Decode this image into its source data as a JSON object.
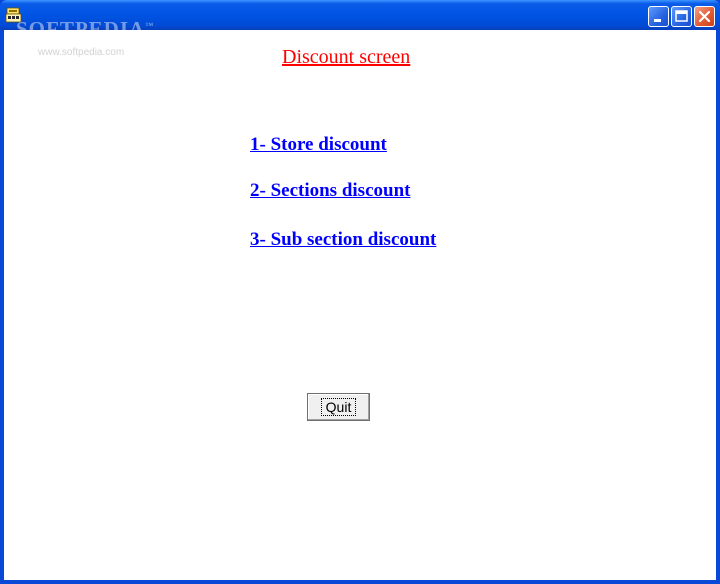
{
  "window": {
    "watermark": "SOFTPEDIA",
    "watermark_tm": "™",
    "watermark_url": "www.softpedia.com"
  },
  "screen": {
    "title": "Discount screen",
    "links": [
      {
        "label": "1- Store discount"
      },
      {
        "label": "2- Sections discount"
      },
      {
        "label": "3- Sub section discount"
      }
    ],
    "quit_label": "Quit"
  },
  "colors": {
    "title": "#ff0000",
    "links": "#0000ff",
    "titlebar": "#0054e3",
    "close_button": "#e35c33"
  }
}
